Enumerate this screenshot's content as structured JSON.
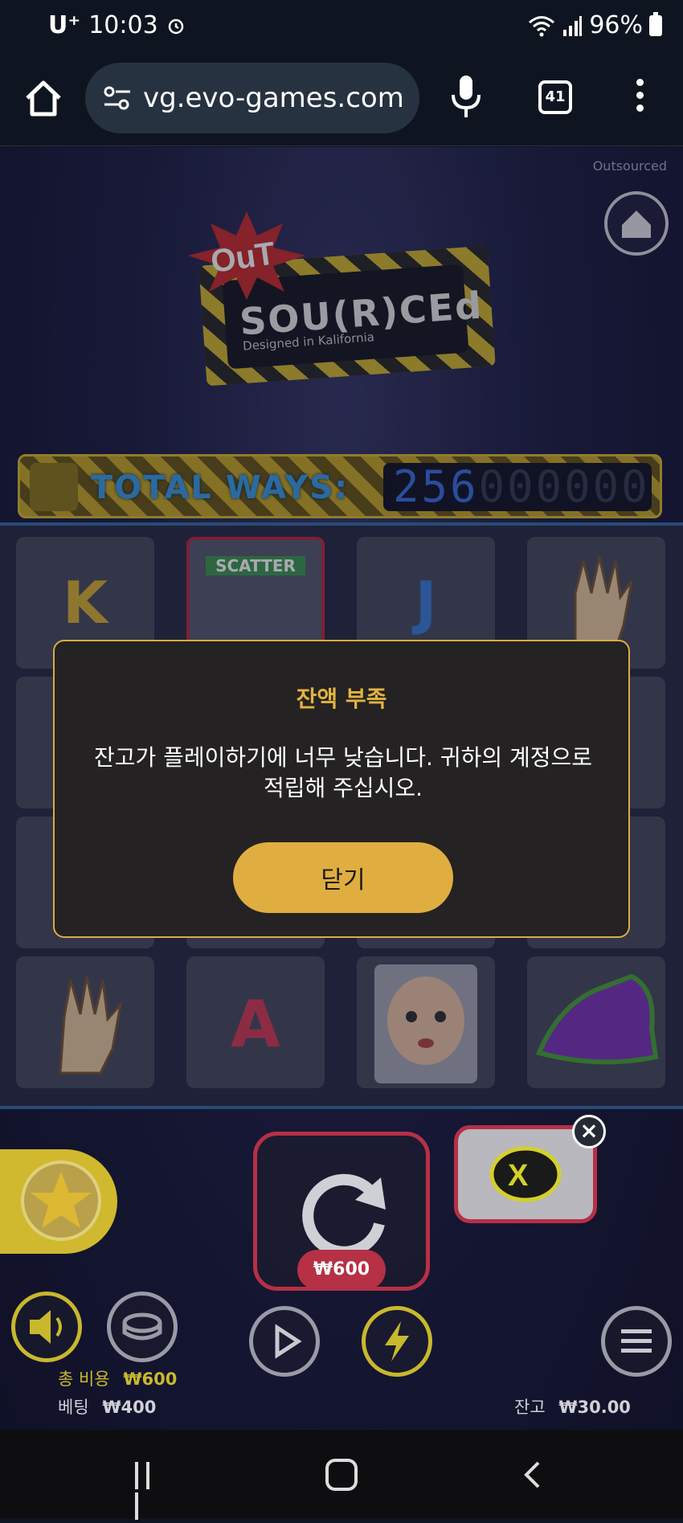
{
  "status_bar": {
    "carrier": "U⁺",
    "time": "10:03",
    "battery": "96%"
  },
  "browser": {
    "url": "vg.evo-games.com",
    "tab_count": "41"
  },
  "game": {
    "provider": "Outsourced",
    "logo_title": "OUT SOU(R)CED",
    "logo_out": "OuT",
    "logo_main": "SOU(R)CEd",
    "logo_sub": "Designed in Kalifornia",
    "ways_label": "TOTAL WAYS:",
    "ways_value": "256",
    "ways_ghost": "000000",
    "reel_symbols": [
      [
        "K",
        "SCATTER",
        "J",
        "hand"
      ],
      [
        "",
        "",
        "",
        ""
      ],
      [
        "",
        "",
        "",
        ""
      ],
      [
        "hand",
        "A",
        "doll",
        "sneaker"
      ]
    ],
    "scatter_label": "SCATTER",
    "spin_cost": "₩600",
    "total_cost_label": "총 비용",
    "total_cost_value": "₩600",
    "bet_label": "베팅",
    "bet_value": "₩400",
    "balance_label": "잔고",
    "balance_value": "₩30.00"
  },
  "modal": {
    "title": "잔액 부족",
    "body": "잔고가 플레이하기에 너무 낮습니다. 귀하의 계정으로 적립해 주십시오.",
    "close_button": "닫기"
  },
  "colors": {
    "accent": "#e0ae40",
    "danger": "#b63046",
    "ways_blue": "#3d72e0"
  }
}
